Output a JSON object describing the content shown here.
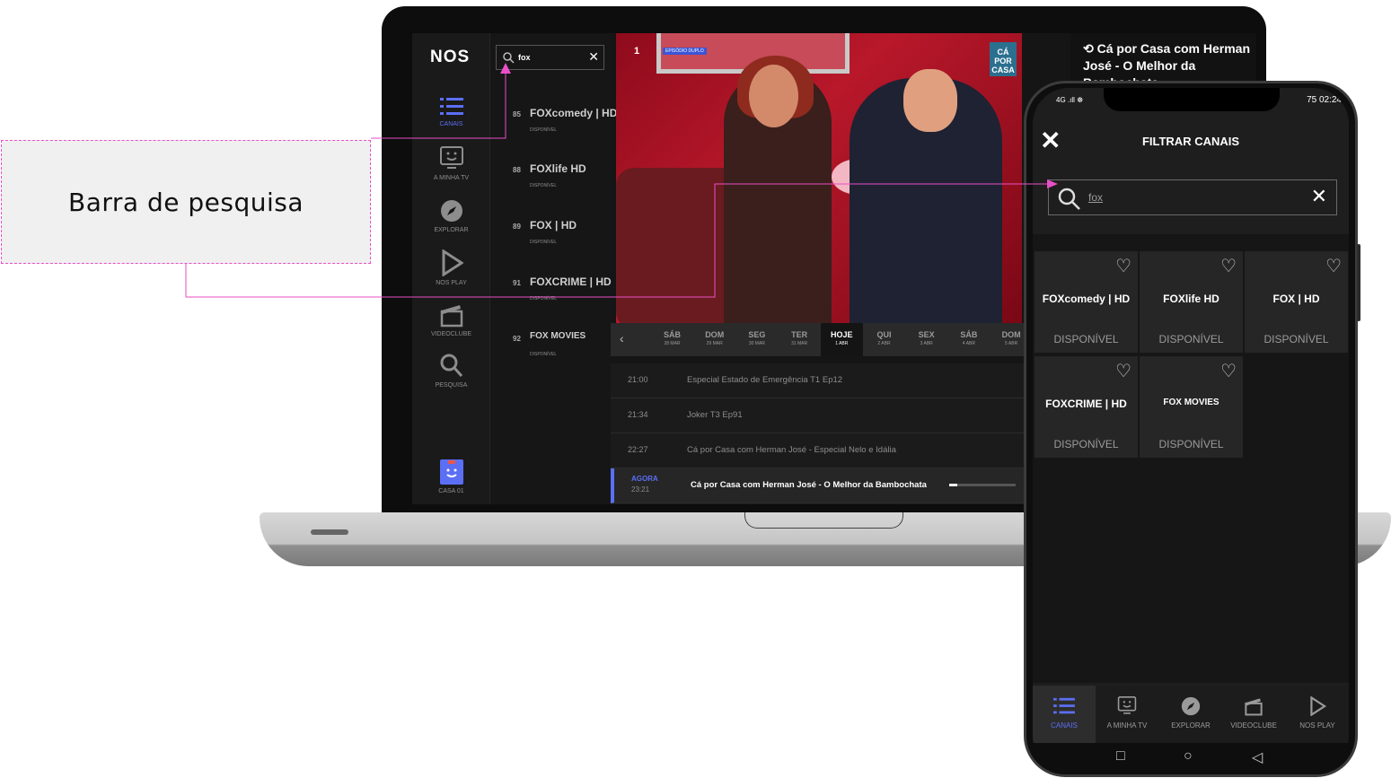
{
  "callout": {
    "label": "Barra de pesquisa"
  },
  "laptop": {
    "logo": "NOS",
    "nav": [
      {
        "label": "CANAIS",
        "icon": "list-icon",
        "active": true
      },
      {
        "label": "A MINHA TV",
        "icon": "tv-icon",
        "active": false
      },
      {
        "label": "EXPLORAR",
        "icon": "compass-icon",
        "active": false
      },
      {
        "label": "NOS PLAY",
        "icon": "play-icon",
        "active": false
      },
      {
        "label": "VIDEOCLUBE",
        "icon": "clapper-icon",
        "active": false
      },
      {
        "label": "PESQUISA",
        "icon": "search-icon",
        "active": false
      }
    ],
    "profile": "CASA 01",
    "search": {
      "query": "fox",
      "clear": "✕"
    },
    "channels": [
      {
        "num": "85",
        "name": "FOXcomedy | HD",
        "status": "DISPONÍVEL"
      },
      {
        "num": "88",
        "name": "FOXlife HD",
        "status": "DISPONÍVEL"
      },
      {
        "num": "89",
        "name": "FOX | HD",
        "status": "DISPONÍVEL"
      },
      {
        "num": "91",
        "name": "FOXCRIME | HD",
        "status": "DISPONÍVEL"
      },
      {
        "num": "92",
        "name": "FOX MOVIES",
        "status": "DISPONÍVEL"
      }
    ],
    "video": {
      "channel": "1",
      "badge": "EPISÓDIO DUPLO",
      "corner_logo": "CÁ POR CASA"
    },
    "info_title": "Cá por Casa com Herman José - O Melhor da Bambochata",
    "days": [
      {
        "d": "SÁB",
        "date": "28 MAR"
      },
      {
        "d": "DOM",
        "date": "29 MAR"
      },
      {
        "d": "SEG",
        "date": "30 MAR"
      },
      {
        "d": "TER",
        "date": "31 MAR"
      },
      {
        "d": "HOJE",
        "date": "1 ABR",
        "active": true
      },
      {
        "d": "QUI",
        "date": "2 ABR"
      },
      {
        "d": "SEX",
        "date": "3 ABR"
      },
      {
        "d": "SÁB",
        "date": "4 ABR"
      },
      {
        "d": "DOM",
        "date": "5 ABR"
      }
    ],
    "schedule": [
      {
        "time": "21:00",
        "title": "Especial Estado de Emergência     T1 Ep12"
      },
      {
        "time": "21:34",
        "title": "Joker     T3 Ep91"
      },
      {
        "time": "22:27",
        "title": "Cá por Casa com Herman José - Especial Nelo e Idália"
      }
    ],
    "now": {
      "label": "AGORA",
      "time": "23:21",
      "title": "Cá por Casa com Herman José - O Melhor da Bambochata",
      "progress": 0.12
    }
  },
  "phone": {
    "status_left": "4G .ıll ☸",
    "status_right": "75 02:24",
    "title": "FILTRAR CANAIS",
    "search_query": "fox",
    "tiles": [
      {
        "name": "FOXcomedy | HD",
        "status": "DISPONÍVEL"
      },
      {
        "name": "FOXlife HD",
        "status": "DISPONÍVEL"
      },
      {
        "name": "FOX | HD",
        "status": "DISPONÍVEL"
      },
      {
        "name": "FOXCRIME | HD",
        "status": "DISPONÍVEL"
      },
      {
        "name": "FOX MOVIES",
        "status": "DISPONÍVEL"
      }
    ],
    "bottom_nav": [
      {
        "label": "CANAIS",
        "active": true
      },
      {
        "label": "A MINHA TV"
      },
      {
        "label": "EXPLORAR"
      },
      {
        "label": "VIDEOCLUBE"
      },
      {
        "label": "NOS PLAY"
      }
    ],
    "accent": "#5b6ff5"
  }
}
